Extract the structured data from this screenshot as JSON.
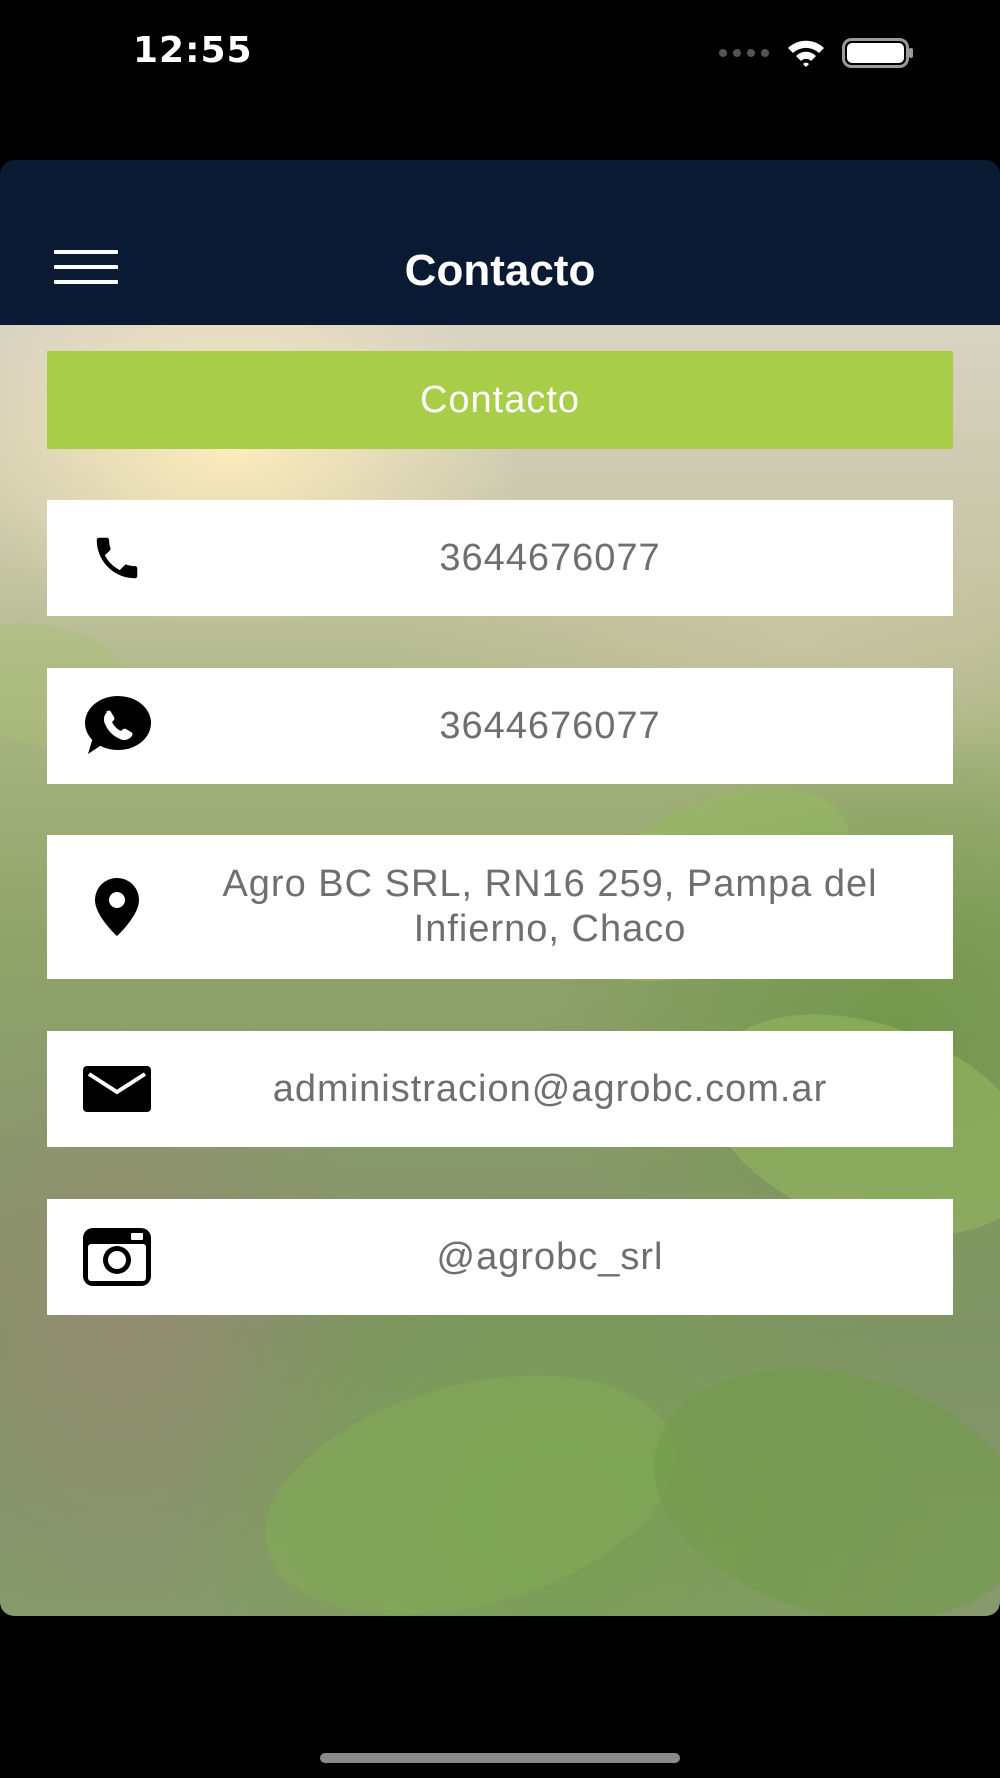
{
  "status_bar": {
    "time": "12:55",
    "icons": [
      "cellular-icon",
      "wifi-icon",
      "battery-icon"
    ]
  },
  "nav": {
    "title": "Contacto",
    "menu_icon": "hamburger-menu-icon"
  },
  "section_header": "Contacto",
  "contacts": [
    {
      "icon": "phone-icon",
      "text": "3644676077"
    },
    {
      "icon": "whatsapp-icon",
      "text": "3644676077"
    },
    {
      "icon": "location-pin-icon",
      "text": "Agro BC SRL, RN16 259, Pampa del Infierno, Chaco"
    },
    {
      "icon": "mail-icon",
      "text": "administracion@agrobc.com.ar"
    },
    {
      "icon": "instagram-icon",
      "text": "@agrobc_srl"
    }
  ],
  "colors": {
    "nav_background": "#0a1a33",
    "accent_green": "#a7cd49",
    "card_background": "#ffffff",
    "text_gray": "#6f6f6f"
  }
}
